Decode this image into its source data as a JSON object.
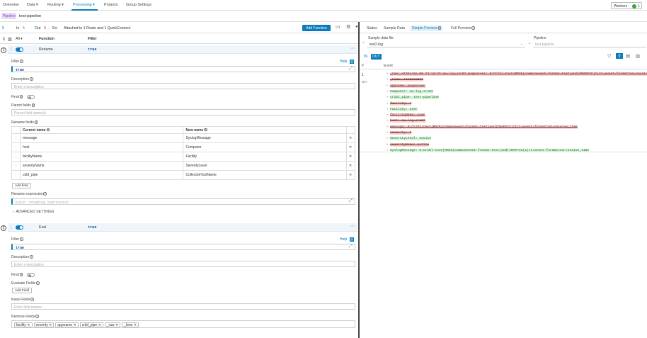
{
  "nav": {
    "items": [
      "Overview",
      "Data",
      "Routing",
      "Processing",
      "Projects",
      "Group Settings"
    ],
    "workers_label": "Workers",
    "workers_count": "1"
  },
  "pipeline": {
    "badge": "Pipeline",
    "name": "test-pipeline"
  },
  "stats": {
    "count": "5",
    "in_label": "In",
    "in_value": "5",
    "out_label": "Out",
    "out_value": "0",
    "err_label": "Err",
    "attached": "Attached to 1 Route and 1 QuickConnect",
    "add_function": "Add Function"
  },
  "columns": {
    "all": "All",
    "function": "Function",
    "filter": "Filter"
  },
  "functions": [
    {
      "num": "1",
      "name": "Rename",
      "filter": "true",
      "help": "Help",
      "filter_label": "Filter",
      "filter_value": "true",
      "description_label": "Description",
      "description_placeholder": "Enter a description",
      "final_label": "Final",
      "parent_label": "Parent fields",
      "parent_placeholder": "Parent field name(s)",
      "rename_fields_label": "Rename fields",
      "current_name_header": "Current name",
      "new_name_header": "New name",
      "rows": [
        {
          "current": "message",
          "new": "SyslogMessage"
        },
        {
          "current": "host",
          "new": "Computer"
        },
        {
          "current": "facilityName",
          "new": "Facility"
        },
        {
          "current": "severityName",
          "new": "SeverityLevel"
        },
        {
          "current": "cribl_pipe",
          "new": "CollectorHostName"
        }
      ],
      "add_field": "Add field",
      "rename_expr_label": "Rename expression",
      "rename_expr_placeholder": "Enter renaming expression",
      "advanced": "ADVANCED SETTINGS"
    },
    {
      "num": "2",
      "name": "Eval",
      "filter": "true",
      "help": "Help",
      "filter_label": "Filter",
      "filter_value": "true",
      "description_label": "Description",
      "description_placeholder": "Enter a description",
      "final_label": "Final",
      "evaluate_label": "Evaluate Fields",
      "add_field": "Add Field",
      "keep_label": "Keep Fields",
      "keep_placeholder": "Enter field names",
      "remove_label": "Remove Fields",
      "remove_fields": [
        "facility",
        "severity",
        "appname",
        "cribl_pipe",
        "_raw",
        "_time"
      ]
    }
  ],
  "right": {
    "tabs": [
      "Status",
      "Sample Data",
      "Simple Preview",
      "Full Preview"
    ],
    "sample_label": "Sample data file",
    "sample_value": "test2.log",
    "pipeline_label": "Pipeline",
    "pipeline_value": "test-pipeline",
    "in_tab": "IN",
    "out_tab": "OUT",
    "hash_col": "#",
    "event_col": "Event",
    "row_num": "1",
    "row_na": "N/A",
    "events": [
      {
        "t": "del",
        "text": "_raw: <134>Jan 08 13:14:33 nw-log-srv01 msgsvrver: 0:Cribl-test|MOCK|commonevent-format-test|end|TRAFFIC|1|rt=event-formatted-receive_time"
      },
      {
        "t": "del",
        "text": "_time: 1736342073"
      },
      {
        "t": "del",
        "text": "appname: msgsvrver"
      },
      {
        "t": "add",
        "text": "Computer: nw-log-srv01"
      },
      {
        "t": "add",
        "text": "cribl_pipe: test-pipeline"
      },
      {
        "t": "del",
        "text": "facility: 1"
      },
      {
        "t": "add",
        "text": "Facility: user"
      },
      {
        "t": "del",
        "text": "facilityName: user"
      },
      {
        "t": "del",
        "text": "host: nw-log-srv01"
      },
      {
        "t": "del",
        "text": "message: 0:Cribl-test|MOCK|commonevent-format-test|end|TRAFFIC|1|rt=event-formatted-receive_time"
      },
      {
        "t": "del",
        "text": "severity: 5"
      },
      {
        "t": "add",
        "text": "SeverityLevel: notice"
      },
      {
        "t": "del",
        "text": "severityName: notice"
      },
      {
        "t": "add",
        "text": "SyslogMessage: 0:Cribl-test|MOCK|commonevent-format-test|end|TRAFFIC|1|rt=event-formatted-receive_time"
      }
    ]
  },
  "colors": {
    "accent": "#0a7bbd",
    "deleted": "#fbd3d3",
    "added": "#d3f5d7"
  }
}
